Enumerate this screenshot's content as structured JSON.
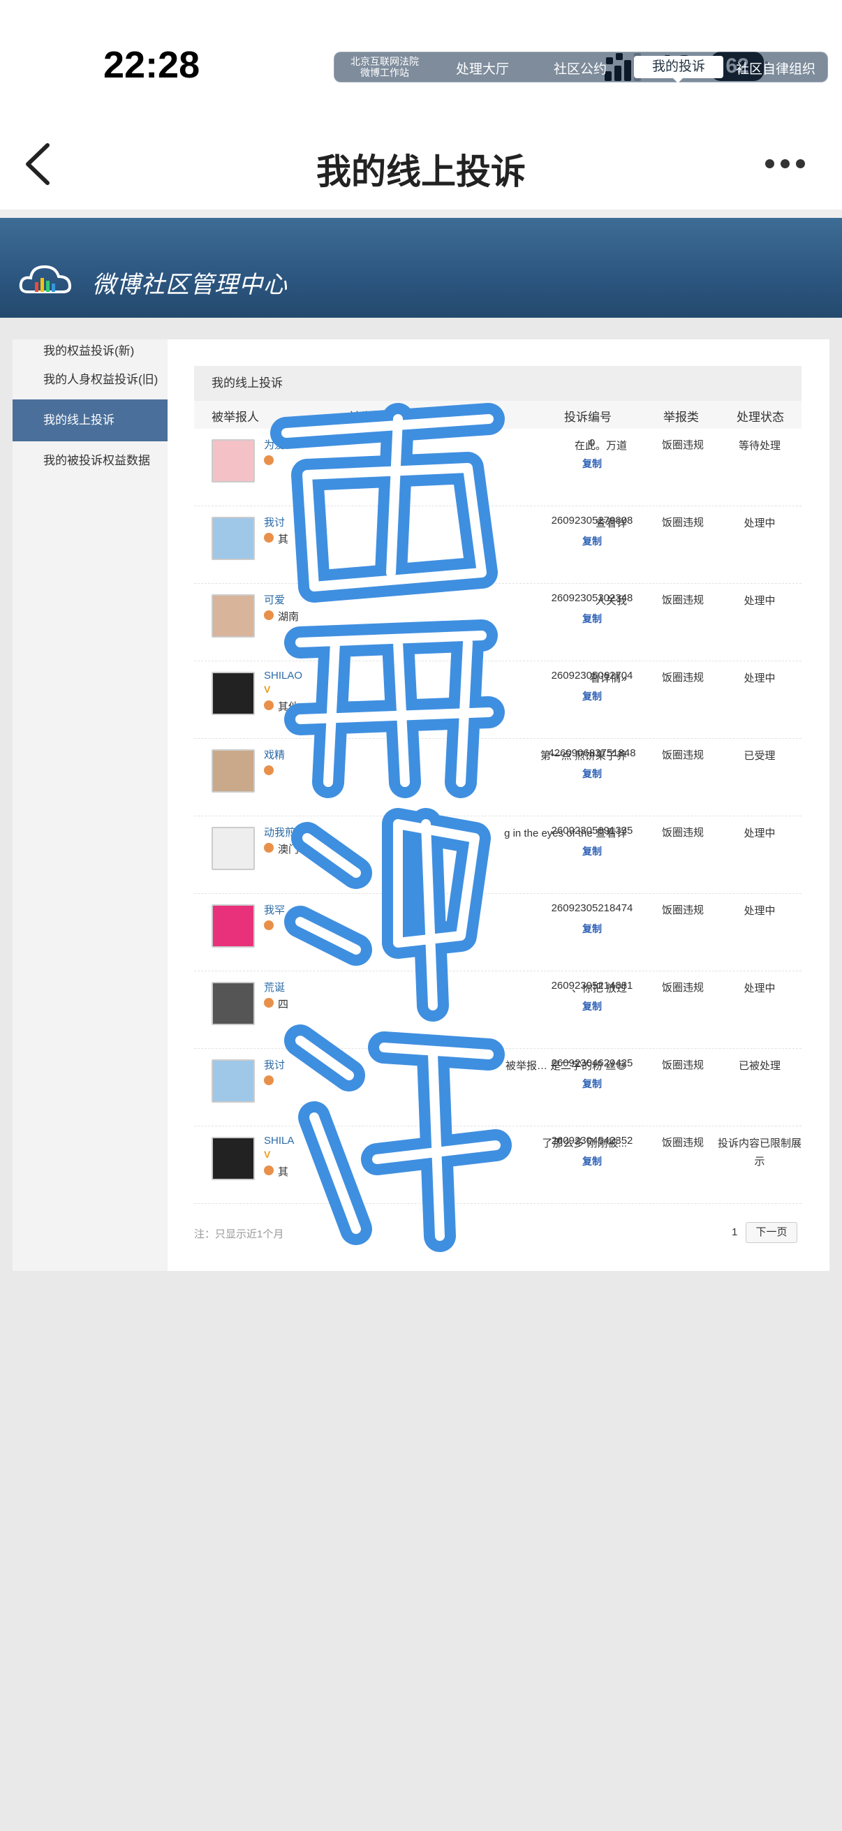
{
  "status_bar": {
    "time": "22:28",
    "network": "4G",
    "battery": "62"
  },
  "nav": {
    "title": "我的线上投诉"
  },
  "header": {
    "logo_text": "微博社区管理中心",
    "beijing_line1": "北京互联网法院",
    "beijing_line2": "微博工作站",
    "tabs": [
      "处理大厅",
      "社区公约",
      "我的投诉",
      "社区自律组织"
    ]
  },
  "sidebar": {
    "items": [
      "我的权益投诉(新)",
      "我的人身权益投诉(旧)",
      "我的线上投诉",
      "我的被投诉权益数据"
    ]
  },
  "content": {
    "title": "我的线上投诉",
    "columns": [
      "被举报人",
      "被举报内容与说明",
      "投诉编号",
      "举报类",
      "处理状态"
    ],
    "copy_label": "复制",
    "rows": [
      {
        "name": "为爱",
        "loc": "",
        "desc": "在此。万道",
        "case": "0",
        "category": "饭圈违规",
        "status": "等待处理"
      },
      {
        "name": "我讨",
        "loc": "其",
        "desc": "查看详",
        "case": "26092305279808",
        "category": "饭圈违规",
        "status": "处理中"
      },
      {
        "name": "可爱",
        "loc": "湖南",
        "desc": "人关我",
        "case": "26092305302348",
        "category": "饭圈违规",
        "status": "处理中"
      },
      {
        "name": "SHILAO",
        "loc": "其他",
        "desc": "看详情»",
        "case": "26092305062704",
        "category": "饭圈违规",
        "status": "处理中"
      },
      {
        "name": "戏精",
        "loc": "",
        "desc": "第一点 煎饼果子养",
        "case": "426090683751848",
        "category": "饭圈违规",
        "status": "已受理"
      },
      {
        "name": "动我煎蛋小",
        "loc": "澳门 其",
        "desc": "g in the eyes of the 查看详",
        "case": "26092305091335",
        "category": "饭圈违规",
        "status": "处理中"
      },
      {
        "name": "我罕",
        "loc": "",
        "desc": "",
        "case": "26092305218474",
        "category": "饭圈违规",
        "status": "处理中"
      },
      {
        "name": "荒诞",
        "loc": "四",
        "desc": "、你把 放过",
        "case": "26092305214881",
        "category": "饭圈违规",
        "status": "处理中"
      },
      {
        "name": "我讨",
        "loc": "",
        "desc": "被举报… 是二字的粉 丝😅",
        "case": "26092304629425",
        "category": "饭圈违规",
        "status": "已被处理"
      },
      {
        "name": "SHILA",
        "loc": "其",
        "desc": "了那么多 刚刚被...",
        "case": "26092304542352",
        "category": "饭圈违规",
        "status": "投诉内容已限制展示"
      }
    ],
    "footer_note": "注：只显示近1个月",
    "page_number": "1",
    "next_page": "下一页"
  },
  "colors": {
    "header_blue": "#2c5680",
    "sidebar_active": "#4a6f9a",
    "watermark": "#3f8fe0"
  }
}
